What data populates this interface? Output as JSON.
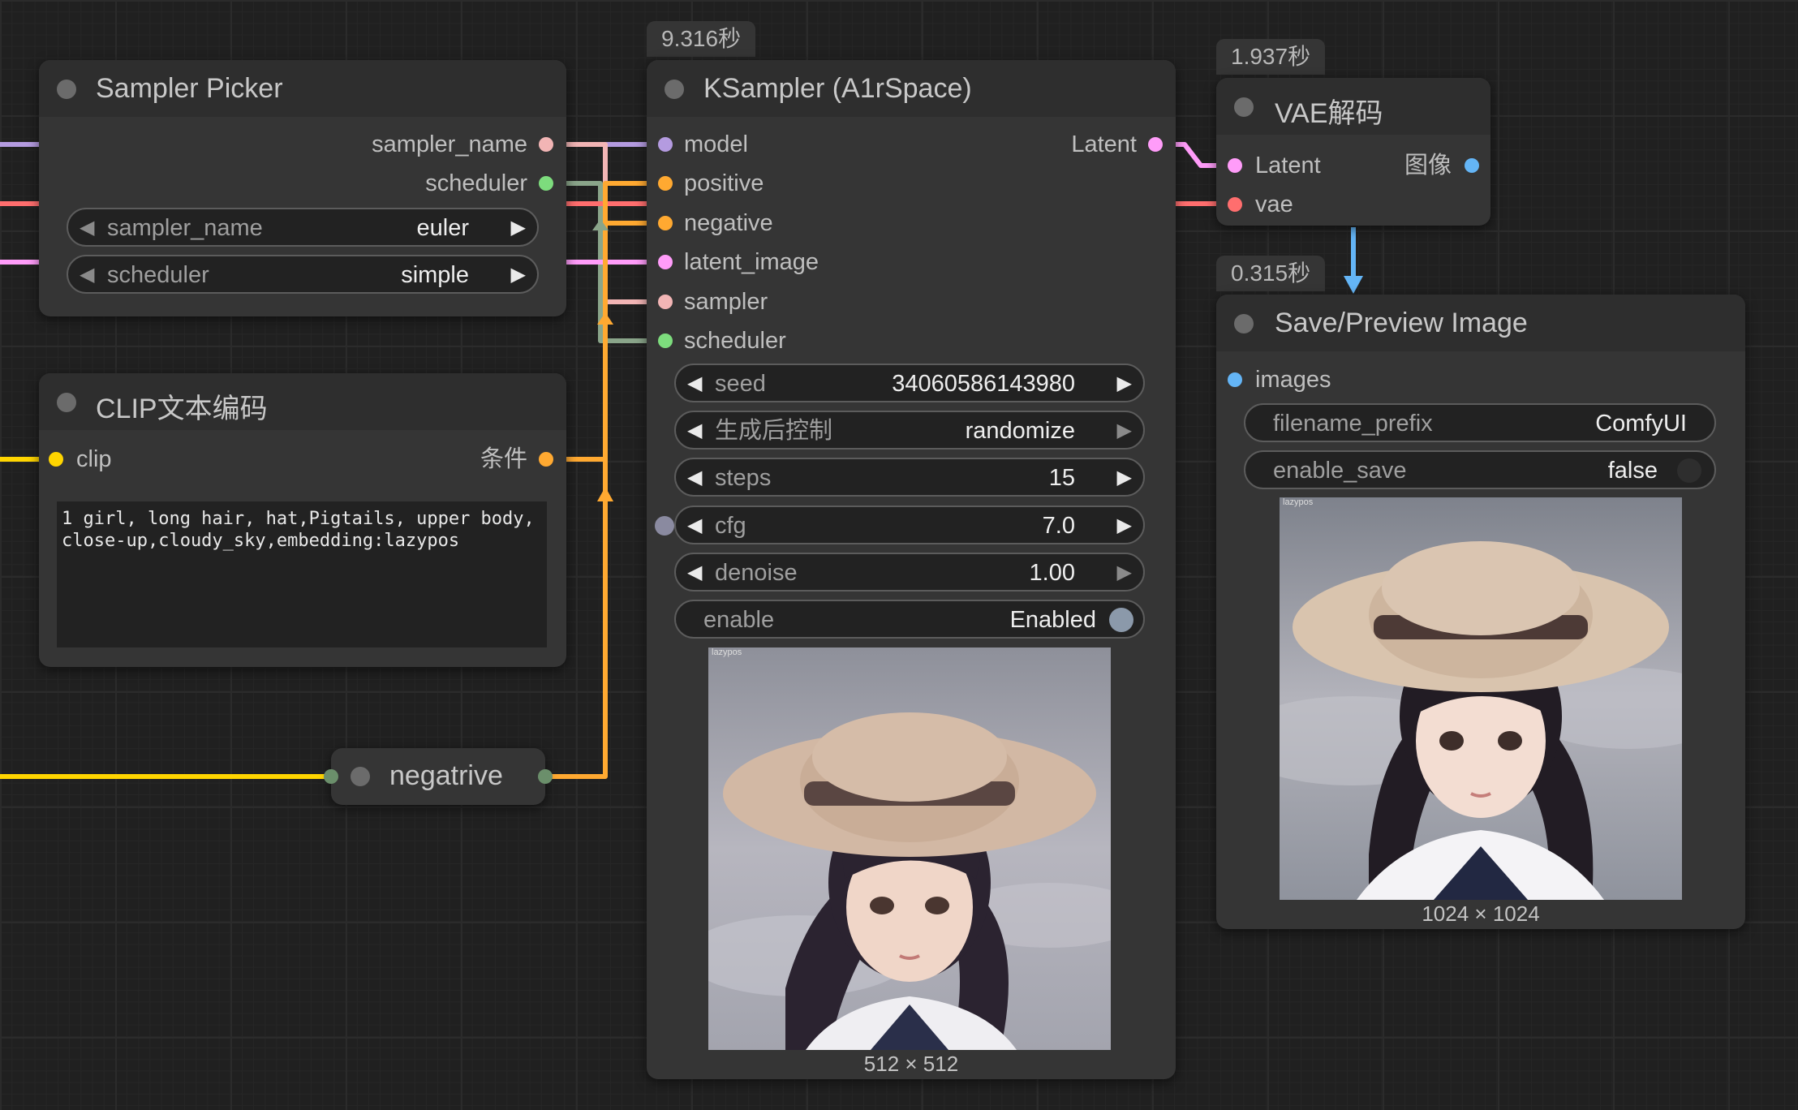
{
  "colors": {
    "model": "#b49be0",
    "conditioning": "#ffa931",
    "latent": "#ff9cf9",
    "vae": "#ff6e6e",
    "image": "#64b5f6",
    "clip": "#ffd500",
    "sampler": "#f2b5b5",
    "scheduler": "#7ddc7d",
    "float": "#8a8aa0"
  },
  "sampler_picker": {
    "title": "Sampler Picker",
    "outputs": [
      "sampler_name",
      "scheduler"
    ],
    "widgets": [
      {
        "label": "sampler_name",
        "value": "euler"
      },
      {
        "label": "scheduler",
        "value": "simple"
      }
    ]
  },
  "clip_encode": {
    "title": "CLIP文本编码",
    "input": "clip",
    "output": "条件",
    "text": "1 girl, long hair, hat,Pigtails, upper body,\nclose-up,cloudy_sky,embedding:lazypos"
  },
  "reroute": {
    "title": "negatrive"
  },
  "ksampler": {
    "badge": "9.316秒",
    "title": "KSampler (A1rSpace)",
    "output": "Latent",
    "inputs": [
      "model",
      "positive",
      "negative",
      "latent_image",
      "sampler",
      "scheduler"
    ],
    "widgets": [
      {
        "label": "seed",
        "value": "34060586143980"
      },
      {
        "label": "生成后控制",
        "value": "randomize"
      },
      {
        "label": "steps",
        "value": "15"
      },
      {
        "label": "cfg",
        "value": "7.0"
      },
      {
        "label": "denoise",
        "value": "1.00"
      }
    ],
    "toggle": {
      "label": "enable",
      "value": "Enabled"
    },
    "image_size": "512 × 512",
    "image_watermark": "lazypos"
  },
  "vae_decode": {
    "badge": "1.937秒",
    "title": "VAE解码",
    "inputs": [
      "Latent",
      "vae"
    ],
    "output": "图像"
  },
  "save_preview": {
    "badge": "0.315秒",
    "title": "Save/Preview Image",
    "input": "images",
    "widgets": [
      {
        "label": "filename_prefix",
        "value": "ComfyUI"
      }
    ],
    "toggle": {
      "label": "enable_save",
      "value": "false"
    },
    "image_size": "1024 × 1024",
    "image_watermark": "lazypos"
  }
}
